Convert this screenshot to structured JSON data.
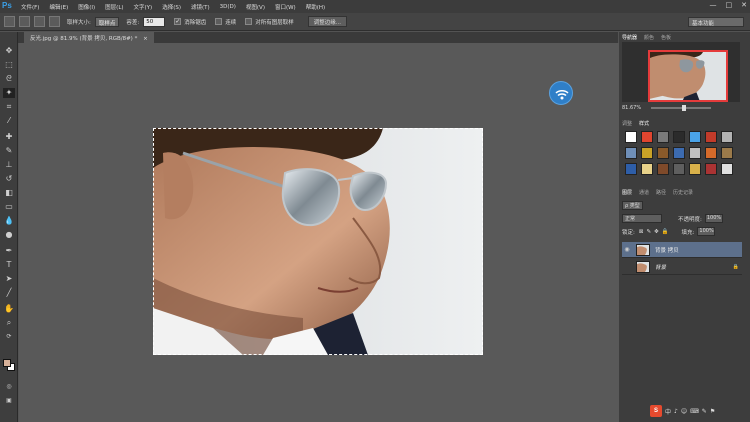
{
  "app": {
    "logo": "Ps",
    "menu": [
      "文件(F)",
      "编辑(E)",
      "图像(I)",
      "图层(L)",
      "文字(Y)",
      "选择(S)",
      "滤镜(T)",
      "3D(D)",
      "视图(V)",
      "窗口(W)",
      "帮助(H)"
    ],
    "window_controls": [
      "—",
      "□",
      "✕"
    ]
  },
  "options_bar": {
    "sample_size_label": "取样大小:",
    "sample_size_value": "取样点",
    "tolerance_label": "容差:",
    "tolerance_value": "50",
    "antialias_label": "消除锯齿",
    "antialias_checked": true,
    "contiguous_label": "连续",
    "contiguous_checked": false,
    "all_layers_label": "对所有图层取样",
    "all_layers_checked": false,
    "refine_edge_button": "调整边缘...",
    "workspace": "基本功能"
  },
  "document": {
    "tab_title": "反光.jpg @ 81.9% (背景 拷贝, RGB/8#) *",
    "close": "×"
  },
  "navigator": {
    "tabs": [
      "导航器",
      "颜色",
      "色板"
    ],
    "zoom": "81.67%"
  },
  "styles_panel": {
    "tabs": [
      "调整",
      "样式"
    ],
    "swatches": [
      "#ffffff",
      "#e0452f",
      "#7a7a7a",
      "#2b2b2b",
      "#4aa3e8",
      "#c23b2a",
      "#b3b3b3",
      "#6f8fb8",
      "#c9a227",
      "#8a5a2a",
      "#3c6bb0",
      "#c0c0c0",
      "#d46a2a",
      "#9b7a4a",
      "#2e5ea8",
      "#e8d28a",
      "#7f4a2a",
      "#5f5f5f",
      "#d9b14a",
      "#a33",
      "#e0e0e0"
    ]
  },
  "layers_panel": {
    "tabs": [
      "图层",
      "通道",
      "路径",
      "历史记录"
    ],
    "filter_label": "ρ 类型",
    "blend_mode": "正常",
    "opacity_label": "不透明度:",
    "opacity_value": "100%",
    "lock_label": "锁定:",
    "fill_label": "填充:",
    "fill_value": "100%",
    "layers": [
      {
        "name": "背景 拷贝",
        "selected": true,
        "visible": true,
        "locked": false
      },
      {
        "name": "背景",
        "selected": false,
        "visible": false,
        "locked": true
      }
    ]
  },
  "tray": {
    "s_label": "S",
    "items": [
      "中",
      "♪",
      "☺",
      "⌨",
      "✎",
      "⚑"
    ]
  }
}
